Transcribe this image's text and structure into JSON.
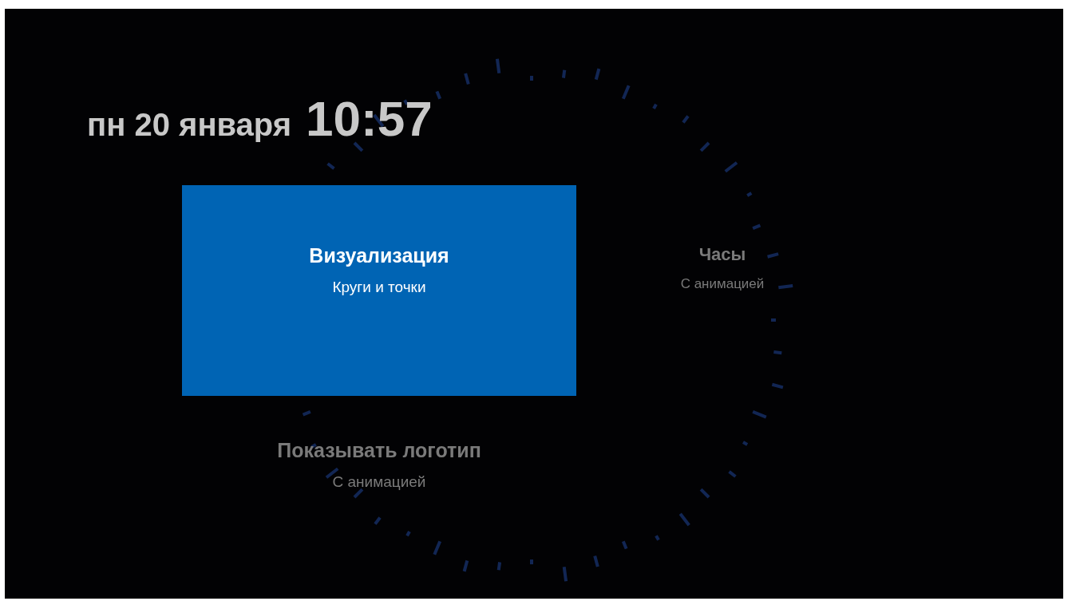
{
  "header": {
    "date": "пн 20 января",
    "time": "10:57"
  },
  "options": [
    {
      "title": "Визуализация",
      "subtitle": "Круги и точки",
      "selected": true
    },
    {
      "title": "Часы",
      "subtitle": "С анимацией",
      "selected": false
    },
    {
      "title": "Показывать логотип",
      "subtitle": "С анимацией",
      "selected": false
    }
  ]
}
